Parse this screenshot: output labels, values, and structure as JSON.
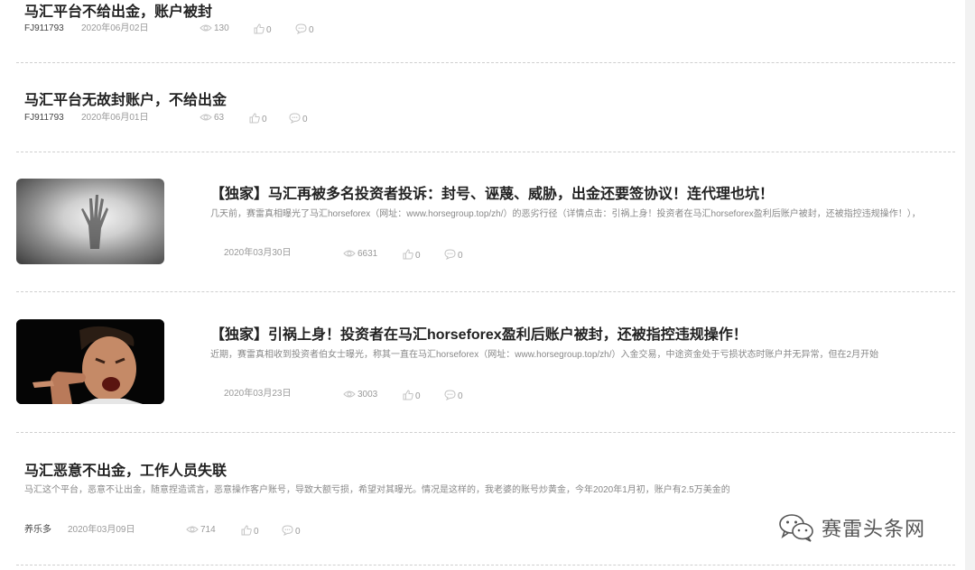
{
  "articles": [
    {
      "title": "马汇平台不给出金，账户被封",
      "author": "FJ911793",
      "date": "2020年06月02日",
      "views": "130",
      "likes": "0",
      "comments": "0"
    },
    {
      "title": "马汇平台无故封账户，不给出金",
      "author": "FJ911793",
      "date": "2020年06月01日",
      "views": "63",
      "likes": "0",
      "comments": "0"
    },
    {
      "title": "【独家】马汇再被多名投资者投诉：封号、诬蔑、威胁，出金还要签协议！连代理也坑！",
      "excerpt": "几天前，赛雷真相曝光了马汇horseforex（网址：www.horsegroup.top/zh/）的恶劣行径（详情点击：引祸上身！投资者在马汇horseforex盈利后账户被封，还被指控违规操作！），",
      "date": "2020年03月30日",
      "views": "6631",
      "likes": "0",
      "comments": "0"
    },
    {
      "title": "【独家】引祸上身！投资者在马汇horseforex盈利后账户被封，还被指控违规操作！",
      "excerpt": "近期，赛雷真相收到投资者伯女士曝光，称其一直在马汇horseforex（网址：www.horsegroup.top/zh/）入金交易，中途资金处于亏损状态时账户并无异常，但在2月开始",
      "date": "2020年03月23日",
      "views": "3003",
      "likes": "0",
      "comments": "0"
    },
    {
      "title": "马汇恶意不出金，工作人员失联",
      "excerpt": "马汇这个平台，恶意不让出金，随意捏造谎言，恶意操作客户账号，导致大额亏损，希望对其曝光。情况是这样的，我老婆的账号炒黄金，今年2020年1月初，账户有2.5万美金的",
      "author": "养乐多",
      "date": "2020年03月09日",
      "views": "714",
      "likes": "0",
      "comments": "0"
    }
  ],
  "watermark": {
    "text": "赛雷头条网",
    "icon": "wechat-icon"
  },
  "colors": {
    "title": "#222222",
    "meta": "#999999",
    "separator": "#cfcfcf"
  }
}
